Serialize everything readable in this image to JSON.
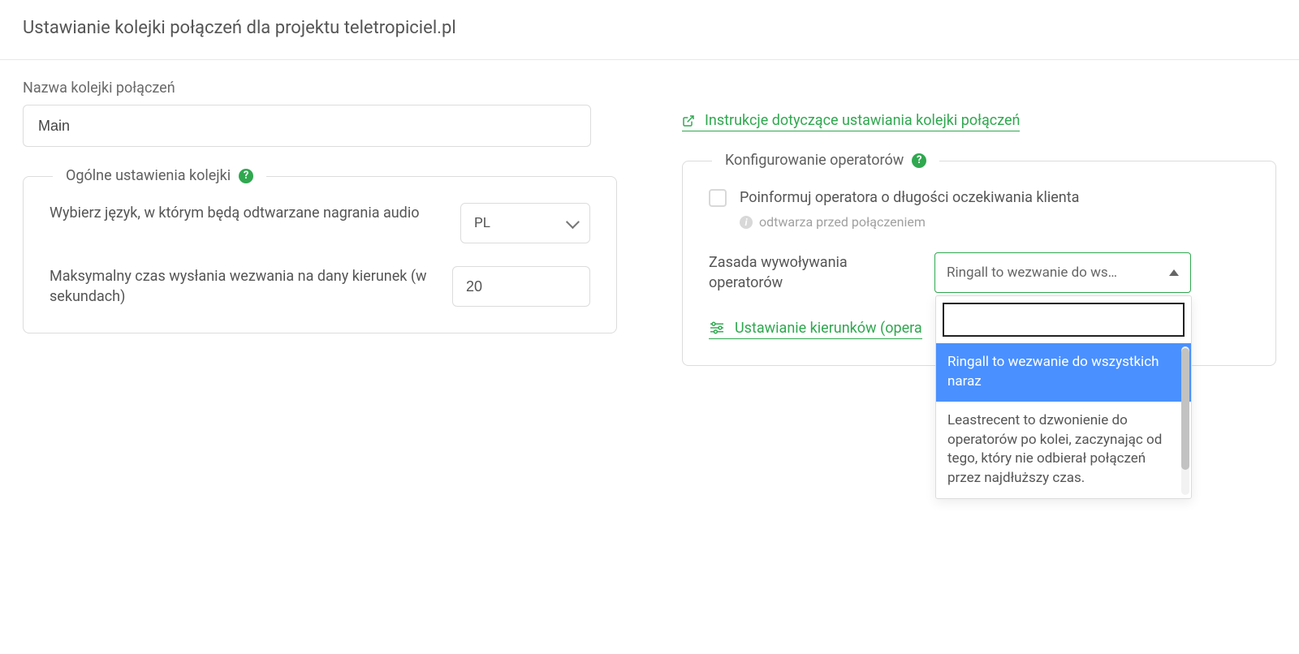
{
  "page_title": "Ustawianie kolejki połączeń dla projektu teletropiciel.pl",
  "queue_name_label": "Nazwa kolejki połączeń",
  "queue_name_value": "Main",
  "instructions_link": "Instrukcje dotyczące ustawiania kolejki połączeń",
  "general": {
    "legend": "Ogólne ustawienia kolejki",
    "lang_label": "Wybierz język, w którym będą odtwarzane nagrania audio",
    "lang_value": "PL",
    "timeout_label": "Maksymalny czas wysłania wezwania na dany kierunek (w sekundach)",
    "timeout_value": "20"
  },
  "operators": {
    "legend": "Konfigurowanie operatorów",
    "inform_label": "Poinformuj operatora o długości oczekiwania klienta",
    "inform_sub": "odtwarza przed połączeniem",
    "rule_label": "Zasada wywoływania operatorów",
    "rule_selected": "Ringall to wezwanie do ws…",
    "dropdown": {
      "search": "",
      "options": [
        "Ringall to wezwanie do wszystkich naraz",
        "Leastrecent to dzwonienie do operatorów po kolei, zaczynając od tego, który nie odbierał połączeń przez najdłuższy czas."
      ]
    },
    "directions_link": "Ustawianie kierunków (opera"
  },
  "icons": {
    "help": "?",
    "info": "i"
  }
}
